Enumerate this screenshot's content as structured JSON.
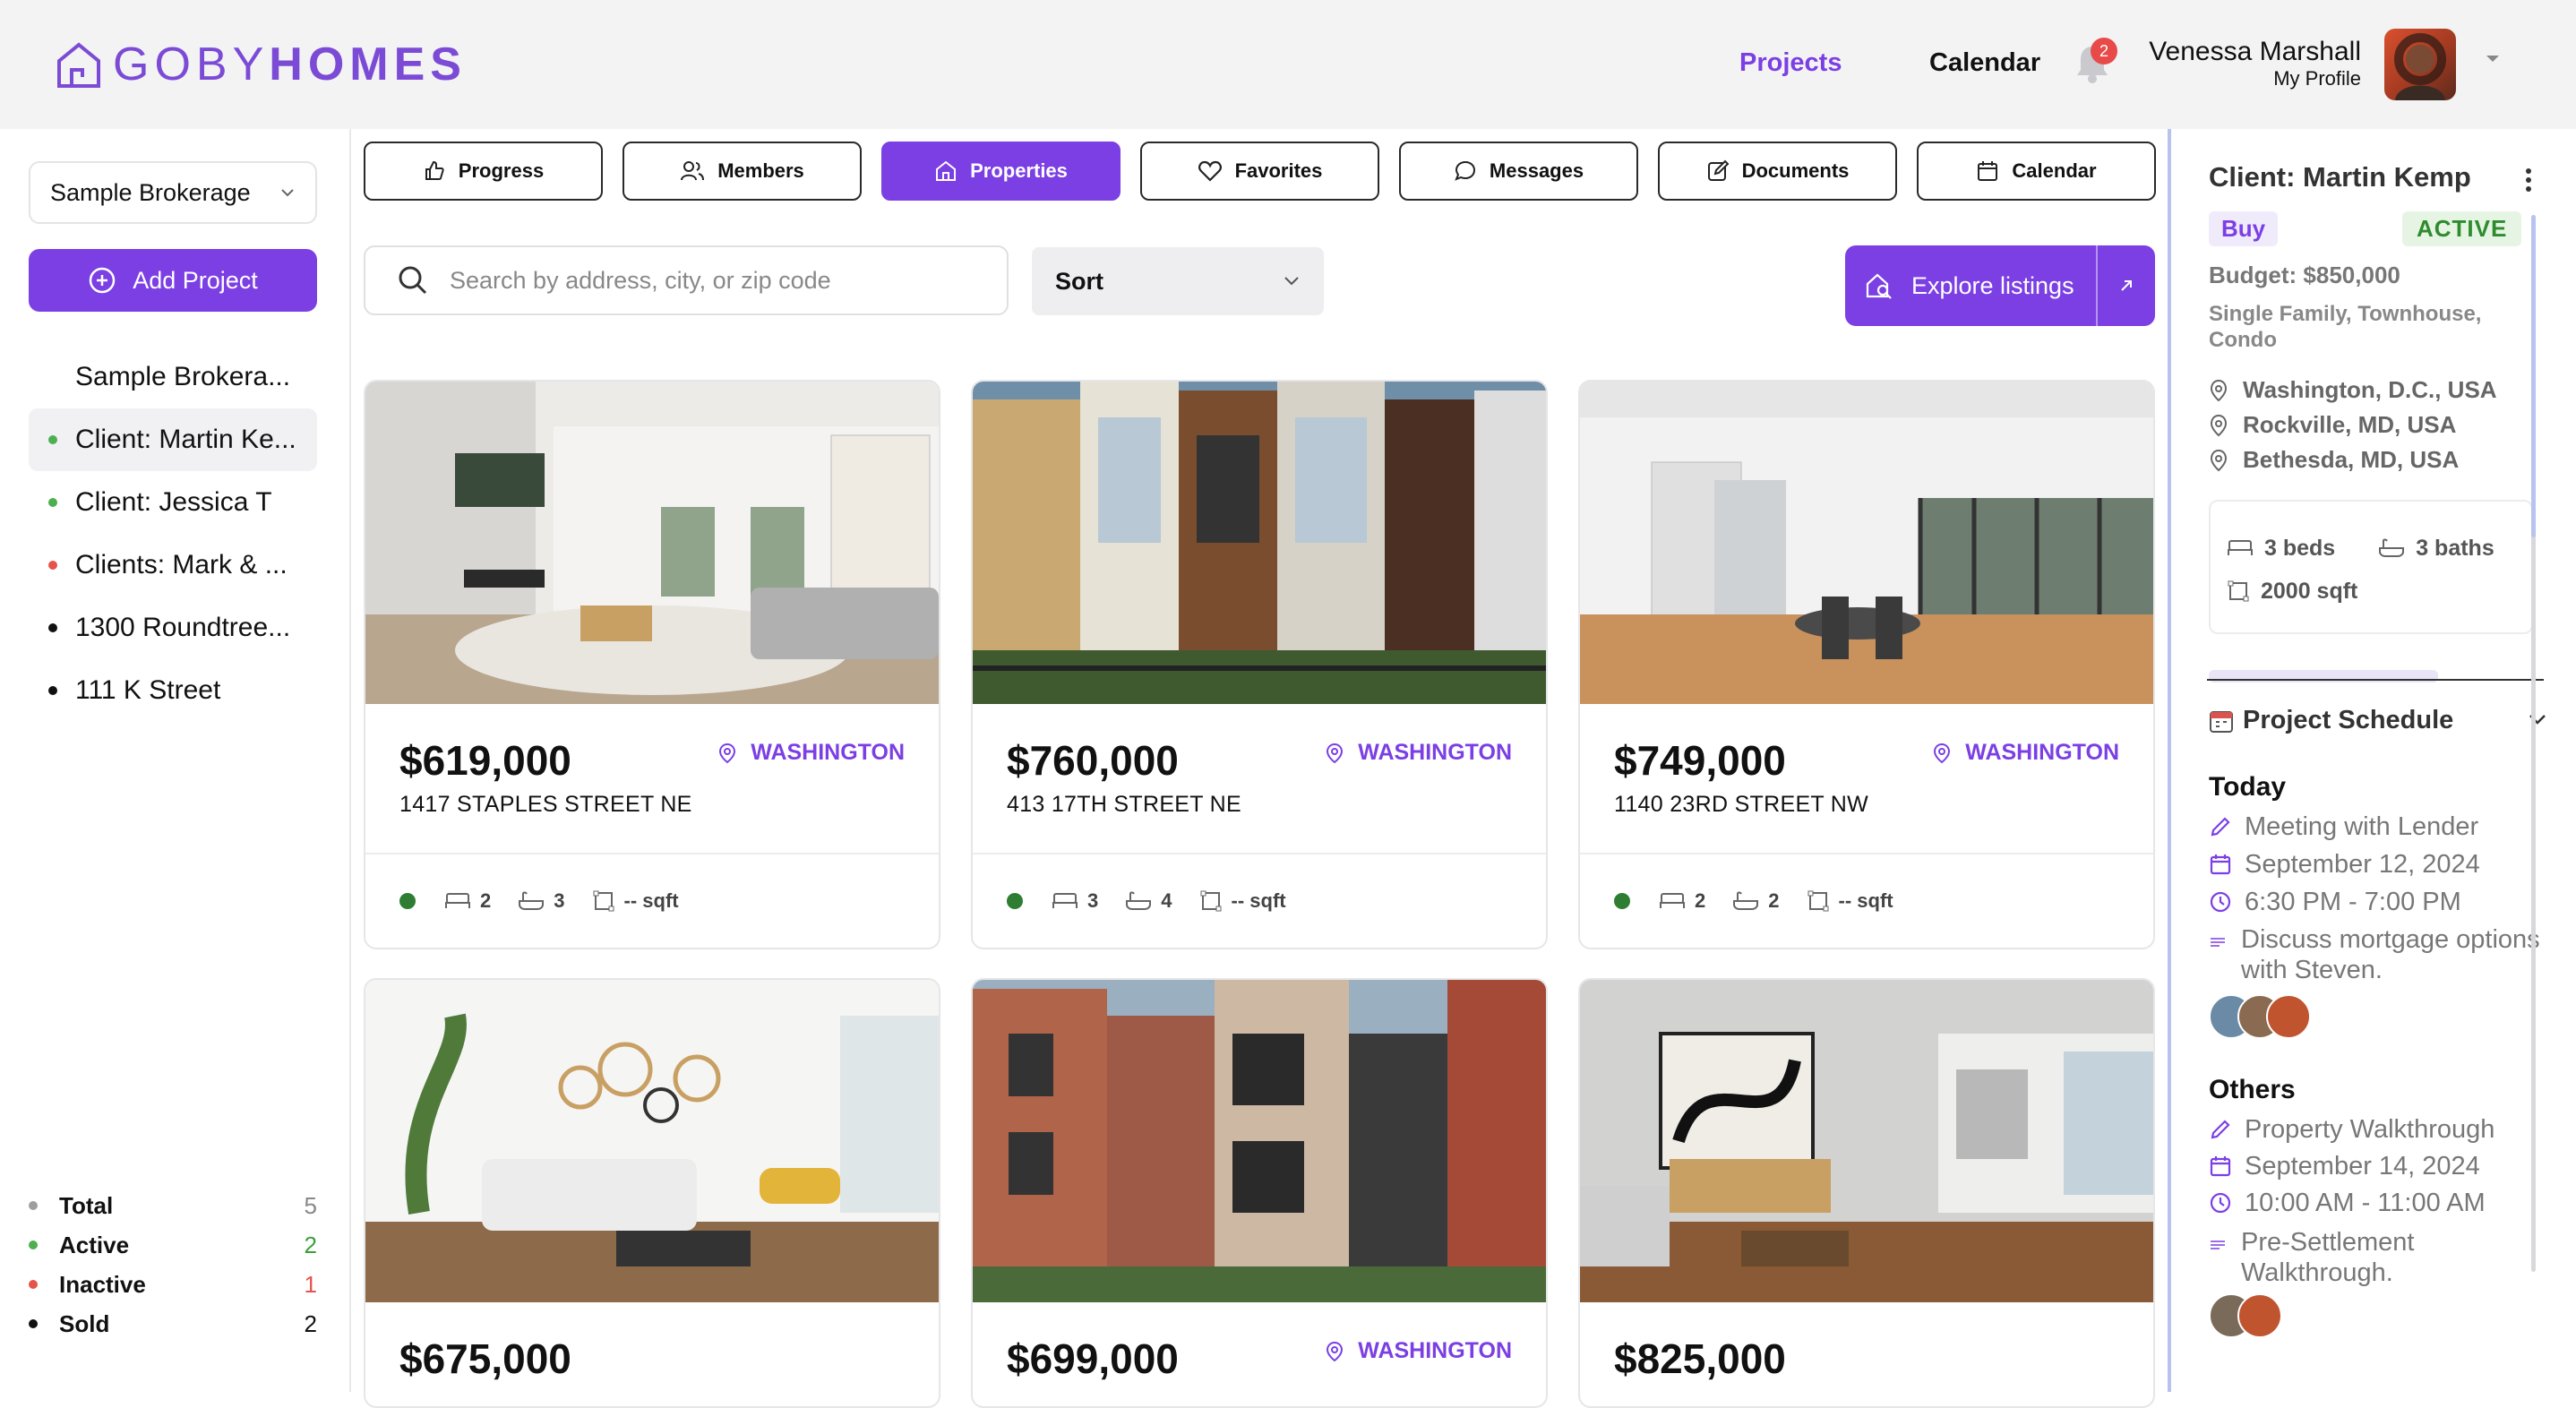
{
  "brand": {
    "logo_part1": "GOBY",
    "logo_part2": "HOMES",
    "accent": "#7b3fe4"
  },
  "nav": {
    "projects": "Projects",
    "calendar": "Calendar",
    "notifications": "2"
  },
  "user": {
    "name": "Venessa Marshall",
    "sub": "My Profile"
  },
  "sidebar": {
    "brokerage": "Sample Brokerage",
    "add_project": "Add Project",
    "projects": [
      {
        "label": "Sample Brokera...",
        "dot": ""
      },
      {
        "label": "Client: Martin Ke...",
        "dot": "#4caf50"
      },
      {
        "label": "Client: Jessica T",
        "dot": "#4caf50"
      },
      {
        "label": "Clients: Mark & ...",
        "dot": "#e5534b"
      },
      {
        "label": "1300 Roundtree...",
        "dot": "#111111"
      },
      {
        "label": "111 K Street",
        "dot": "#111111"
      }
    ],
    "stats": [
      {
        "label": "Total",
        "value": "5",
        "dot": "#9e9e9e",
        "vcolor": "#888888"
      },
      {
        "label": "Active",
        "value": "2",
        "dot": "#4caf50",
        "vcolor": "#3aa03a"
      },
      {
        "label": "Inactive",
        "value": "1",
        "dot": "#e5534b",
        "vcolor": "#e5534b"
      },
      {
        "label": "Sold",
        "value": "2",
        "dot": "#111111",
        "vcolor": "#111111"
      }
    ]
  },
  "tabs": [
    "Progress",
    "Members",
    "Properties",
    "Favorites",
    "Messages",
    "Documents",
    "Calendar"
  ],
  "search": {
    "placeholder": "Search by address, city, or zip code"
  },
  "sort": {
    "label": "Sort"
  },
  "explore": {
    "label": "Explore listings"
  },
  "listings": [
    {
      "price": "$619,000",
      "city": "WASHINGTON",
      "address": "1417 STAPLES STREET NE",
      "beds": "2",
      "baths": "3",
      "sqft": "-- sqft"
    },
    {
      "price": "$760,000",
      "city": "WASHINGTON",
      "address": "413 17TH STREET NE",
      "beds": "3",
      "baths": "4",
      "sqft": "-- sqft"
    },
    {
      "price": "$749,000",
      "city": "WASHINGTON",
      "address": "1140 23RD STREET NW",
      "beds": "2",
      "baths": "2",
      "sqft": "-- sqft"
    },
    {
      "price": "$675,000",
      "city": "",
      "address": "",
      "beds": "",
      "baths": "",
      "sqft": ""
    },
    {
      "price": "$699,000",
      "city": "WASHINGTON",
      "address": "",
      "beds": "",
      "baths": "",
      "sqft": ""
    },
    {
      "price": "$825,000",
      "city": "",
      "address": "",
      "beds": "",
      "baths": "",
      "sqft": ""
    }
  ],
  "client": {
    "title": "Client: Martin Kemp",
    "type": "Buy",
    "status": "ACTIVE",
    "budget": "Budget: $850,000",
    "property_types": "Single Family, Townhouse, Condo",
    "cities": [
      "Washington, D.C., USA",
      "Rockville, MD, USA",
      "Bethesda, MD, USA"
    ],
    "beds": "3 beds",
    "baths": "3 baths",
    "sqft": "2000 sqft"
  },
  "schedule": {
    "title": "Project Schedule",
    "today_label": "Today",
    "today": {
      "title": "Meeting with Lender",
      "date": "September 12, 2024",
      "time": "6:30 PM - 7:00 PM",
      "note": "Discuss mortgage options with Steven."
    },
    "others_label": "Others",
    "other": {
      "title": "Property Walkthrough",
      "date": "September 14, 2024",
      "time": "10:00 AM - 11:00 AM",
      "note": "Pre-Settlement Walkthrough."
    }
  }
}
